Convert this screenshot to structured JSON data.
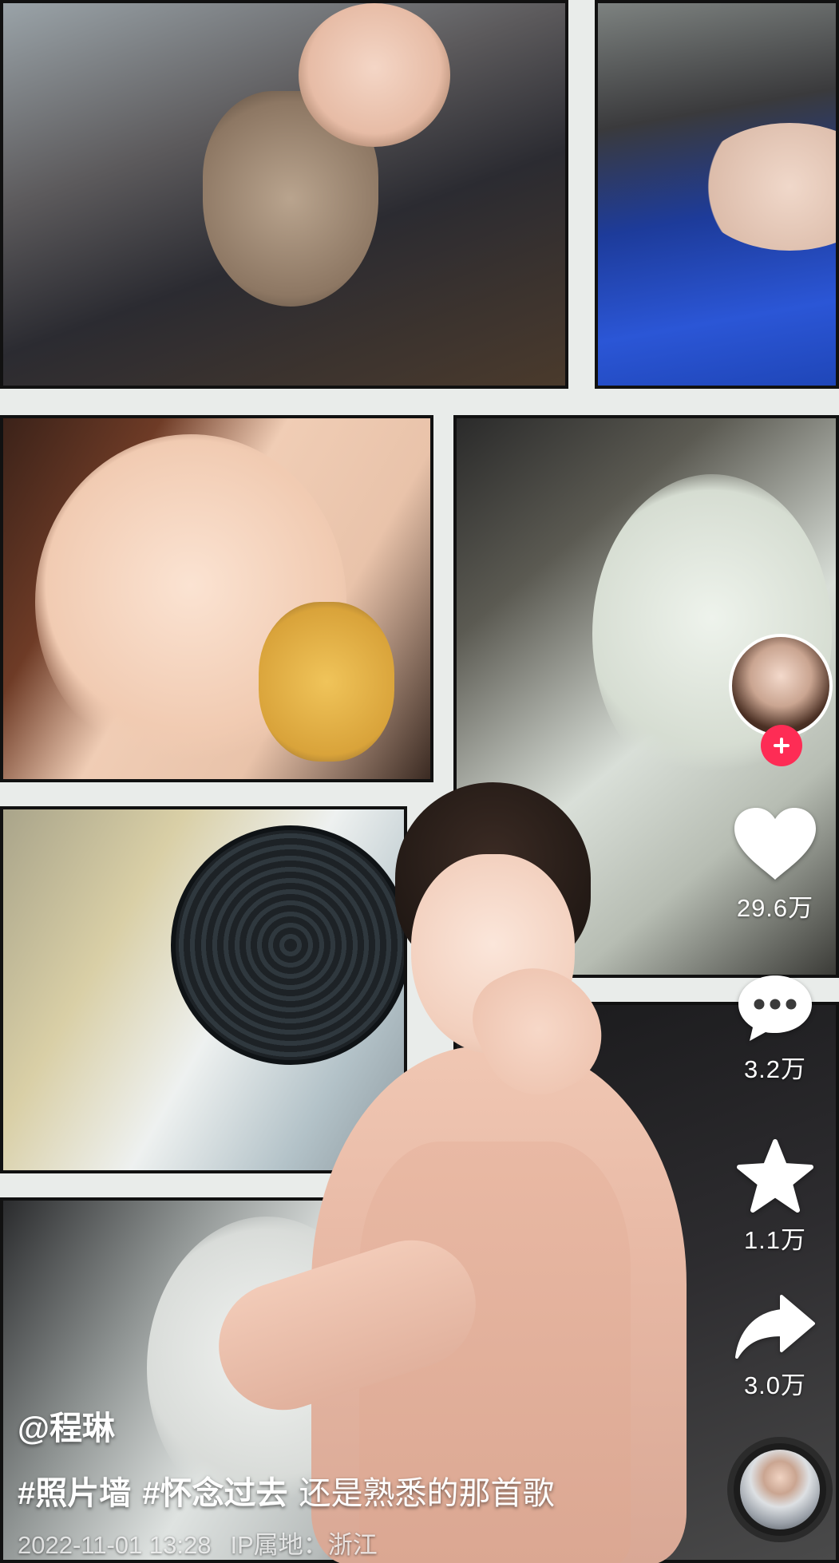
{
  "video": {
    "author": "@程琳",
    "hashtags": [
      "#照片墙",
      "#怀念过去"
    ],
    "description": "还是熟悉的那首歌",
    "timestamp": "2022-11-01 13:28",
    "ip_location": "IP属地：浙江"
  },
  "actions": {
    "likes": "29.6万",
    "comments": "3.2万",
    "favorites": "1.1万",
    "shares": "3.0万"
  },
  "icons": {
    "follow": "plus-icon",
    "like": "heart-icon",
    "comment": "comment-bubble-icon",
    "favorite": "star-icon",
    "share": "share-arrow-icon",
    "music": "music-disc-icon"
  },
  "colors": {
    "follow_button": "#fe2c55",
    "icon": "#ffffff"
  }
}
